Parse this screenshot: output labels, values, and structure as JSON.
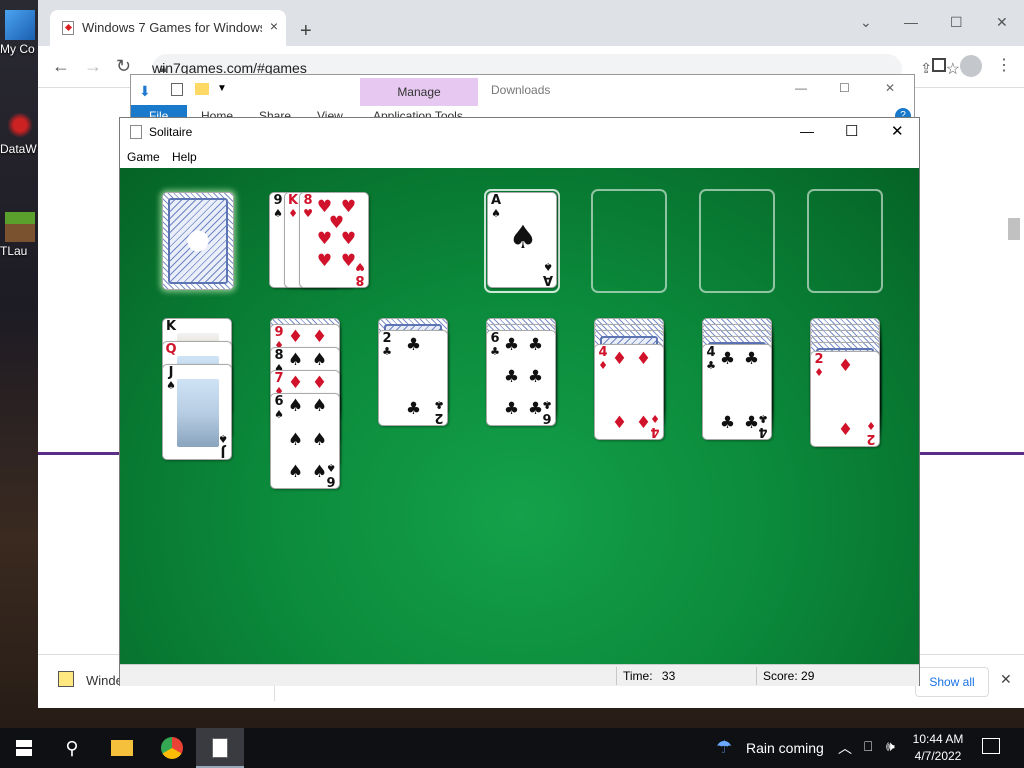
{
  "desktop": {
    "icons": [
      {
        "label": "My Co"
      },
      {
        "label": "DataW"
      },
      {
        "label": "TLau"
      }
    ]
  },
  "browser": {
    "tab_title": "Windows 7 Games for Windows",
    "tab_close": "×",
    "new_tab": "+",
    "url": "win7games.com/#games",
    "back": "←",
    "forward": "→",
    "reload": "↻",
    "window_controls": {
      "minimize": "—",
      "restore": "☐",
      "close": "✕",
      "tab_search": "⌄"
    },
    "download_item": "Winde",
    "show_all": "Show all",
    "download_close": "✕"
  },
  "explorer": {
    "file": "File",
    "home": "Home",
    "share": "Share",
    "view": "View",
    "manage": "Manage",
    "app_tools": "Application Tools",
    "downloads": "Downloads"
  },
  "solitaire": {
    "title": "Solitaire",
    "menu": {
      "game": "Game",
      "help": "Help"
    },
    "window_controls": {
      "minimize": "—",
      "maximize": "☐",
      "close": "✕"
    },
    "status": {
      "time_label": "Time:",
      "time_value": "33",
      "score": "Score: 29"
    },
    "waste": [
      {
        "rank": "9",
        "suit": "♠",
        "color": "black"
      },
      {
        "rank": "K",
        "suit": "♦",
        "color": "red"
      },
      {
        "rank": "8",
        "suit": "♥",
        "color": "red"
      }
    ],
    "foundation": [
      {
        "rank": "A",
        "suit": "♠",
        "color": "black"
      }
    ],
    "tableau": [
      {
        "cards": [
          {
            "rank": "K",
            "suit": "♠"
          },
          {
            "rank": "Q",
            "suit": "♦"
          },
          {
            "rank": "J",
            "suit": "♠"
          }
        ]
      },
      {
        "cards": [
          {
            "rank": "9",
            "suit": "♦"
          },
          {
            "rank": "8",
            "suit": "♠"
          },
          {
            "rank": "7",
            "suit": "♦"
          },
          {
            "rank": "6",
            "suit": "♠"
          }
        ]
      },
      {
        "cards": [
          {
            "rank": "2",
            "suit": "♣"
          }
        ]
      },
      {
        "cards": [
          {
            "rank": "6",
            "suit": "♣"
          }
        ]
      },
      {
        "cards": [
          {
            "rank": "4",
            "suit": "♦"
          }
        ]
      },
      {
        "cards": [
          {
            "rank": "4",
            "suit": "♣"
          }
        ]
      },
      {
        "cards": [
          {
            "rank": "2",
            "suit": "♦"
          }
        ]
      }
    ]
  },
  "taskbar": {
    "weather": "Rain coming",
    "time": "10:44 AM",
    "date": "4/7/2022"
  }
}
